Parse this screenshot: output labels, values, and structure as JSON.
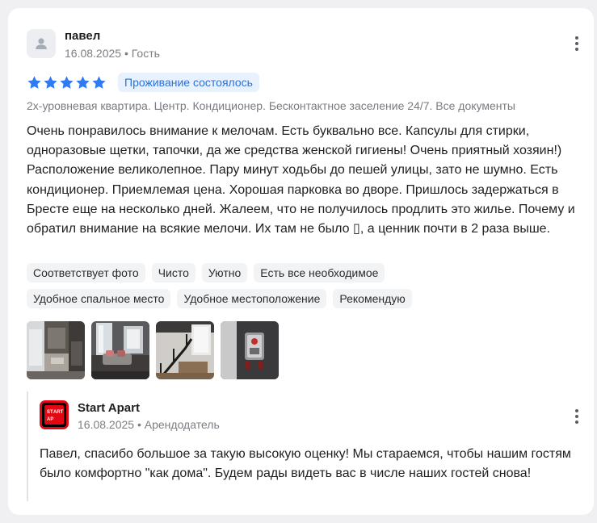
{
  "review": {
    "author": "павел",
    "date": "16.08.2025",
    "role": "Гость",
    "rating": 5,
    "stay_badge": "Проживание состоялось",
    "listing": "2х-уровневая квартира. Центр. Кондиционер. Бесконтактное заселение 24/7. Все документы",
    "text": "Очень понравилось внимание к мелочам. Есть буквально все. Капсулы для стирки, одноразовые щетки, тапочки, да же средства женской гигиены! Очень приятный хозяин!) Расположение великолепное. Пару минут ходьбы до пешей улицы, зато не шумно. Есть кондиционер. Приемлемая цена. Хорошая парковка во дворе. Пришлось задержаться в Бресте еще на несколько дней. Жалеем, что не получилось продлить это жилье. Почему и обратил внимание на всякие мелочи. Их там не было ▯, а ценник почти в 2 раза выше.",
    "tags_row1": [
      "Соответствует фото",
      "Чисто",
      "Уютно",
      "Есть все необходимое"
    ],
    "tags_row2": [
      "Удобное спальное место",
      "Удобное местоположение",
      "Рекомендую"
    ],
    "photos": [
      "photo-1",
      "photo-2",
      "photo-3",
      "photo-4"
    ]
  },
  "reply": {
    "author": "Start Apart",
    "date": "16.08.2025",
    "role": "Арендодатель",
    "logo_text_top": "ART",
    "logo_text_left": "ST",
    "logo_text_bottom": "AP",
    "text": "Павел, спасибо большое за такую высокую оценку! Мы стараемся, чтобы нашим гостям было комфортно \"как дома\". Будем рады видеть вас в числе наших гостей снова!"
  },
  "icons": {
    "avatar": "user-icon",
    "menu": "more-vertical-icon",
    "star": "star-icon"
  },
  "colors": {
    "star": "#2f7bf5",
    "badge_bg": "#e8f1fe",
    "badge_text": "#2a73d7",
    "logo_red": "#e30613"
  }
}
